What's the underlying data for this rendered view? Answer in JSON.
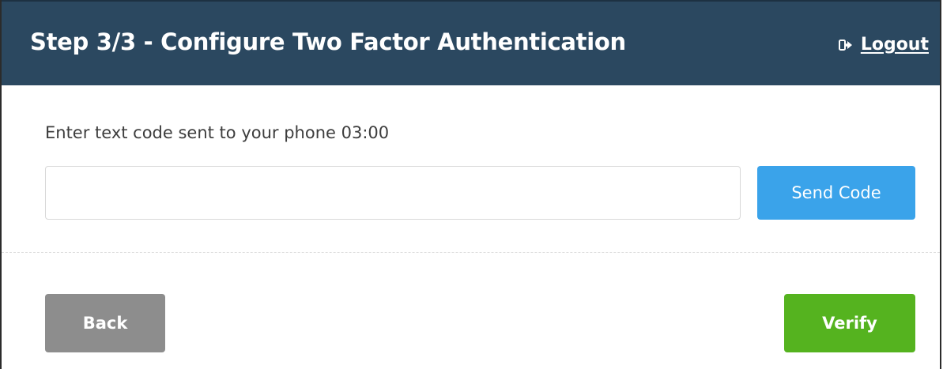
{
  "header": {
    "title": "Step 3/3 - Configure Two Factor Authentication",
    "logout_label": "Logout",
    "logout_icon": "sign-out-icon"
  },
  "form": {
    "prompt": "Enter text code sent to your phone 03:00",
    "code_value": "",
    "code_placeholder": "",
    "send_code_label": "Send Code"
  },
  "footer": {
    "back_label": "Back",
    "verify_label": "Verify"
  },
  "colors": {
    "header_bg": "#2b4860",
    "send_button": "#3aa3ea",
    "back_button": "#8d8d8d",
    "verify_button": "#55b31f"
  }
}
